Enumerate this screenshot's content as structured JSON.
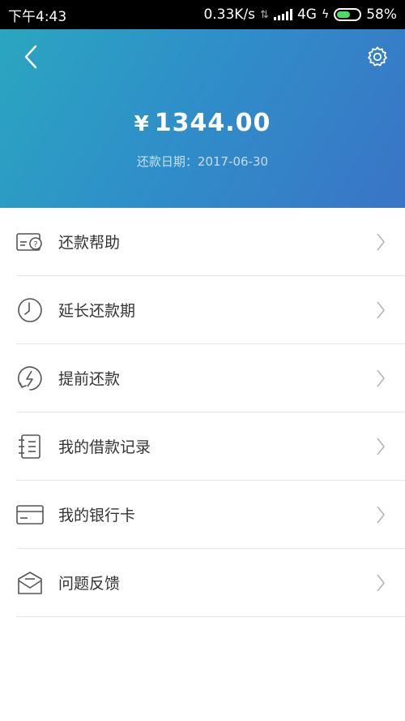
{
  "status_bar": {
    "time": "下午4:43",
    "speed": "0.33K/s",
    "network": "4G",
    "battery": "58%"
  },
  "header": {
    "currency": "¥",
    "amount": "1344.00",
    "due_date": "还款日期：2017-06-30"
  },
  "menu": {
    "items": [
      {
        "label": "还款帮助",
        "icon": "card-help-icon"
      },
      {
        "label": "延长还款期",
        "icon": "clock-icon"
      },
      {
        "label": "提前还款",
        "icon": "lightning-icon"
      },
      {
        "label": "我的借款记录",
        "icon": "record-list-icon"
      },
      {
        "label": "我的银行卡",
        "icon": "bank-card-icon"
      },
      {
        "label": "问题反馈",
        "icon": "mail-icon"
      }
    ]
  },
  "colors": {
    "header_start": "#2aa6c0",
    "header_end": "#3a74c6",
    "icon_stroke": "#555555",
    "chevron": "#b5b5b5"
  }
}
